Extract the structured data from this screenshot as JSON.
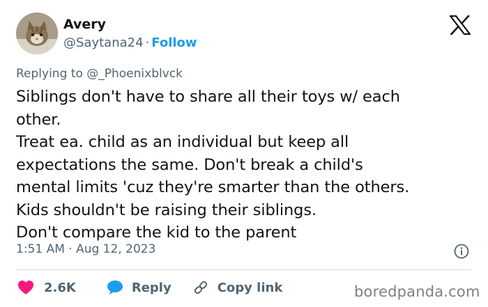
{
  "user": {
    "name": "Avery",
    "handle": "@Saytana24",
    "separator": "·",
    "follow_label": "Follow"
  },
  "reply_to": {
    "prefix": "Replying to",
    "mention": "@_Phoenixblvck"
  },
  "tweet": {
    "lines": [
      "Siblings don't have to share all their toys w/ each",
      "other.",
      "Treat ea. child as an individual but keep all",
      "expectations the same. Don't break a child's",
      "mental limits 'cuz they're smarter than the others.",
      "Kids shouldn't be raising their siblings.",
      "Don't compare the kid to the parent"
    ]
  },
  "meta": {
    "timestamp": "1:51 AM · Aug 12, 2023"
  },
  "actions": {
    "likes_count": "2.6K",
    "reply_label": "Reply",
    "copy_link_label": "Copy link"
  },
  "watermark": "boredpanda.com",
  "colors": {
    "like": "#f91880",
    "reply": "#1d9bf0",
    "link_accent": "#1d9bf0",
    "secondary_text": "#536471",
    "divider": "#cfd9de"
  },
  "icons": {
    "platform": "x-logo-icon",
    "like": "heart-icon",
    "reply": "speech-bubble-icon",
    "copy": "link-icon",
    "info": "info-icon"
  }
}
